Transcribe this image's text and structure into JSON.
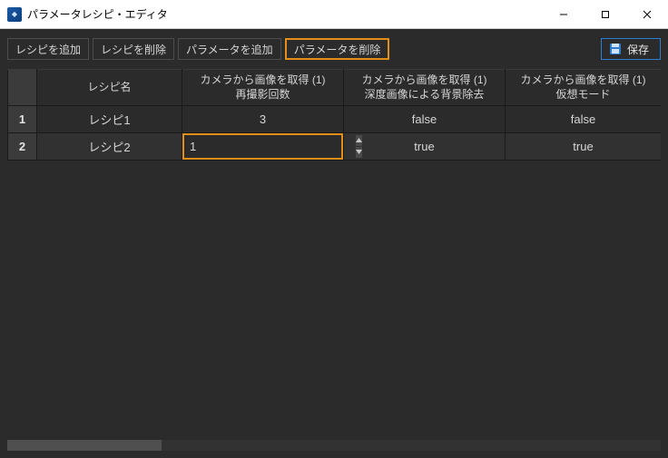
{
  "window": {
    "title": "パラメータレシピ・エディタ"
  },
  "toolbar": {
    "add_recipe": "レシピを追加",
    "delete_recipe": "レシピを削除",
    "add_param": "パラメータを追加",
    "delete_param": "パラメータを削除",
    "save": "保存"
  },
  "table": {
    "headers": {
      "name": "レシピ名",
      "col1_line1": "カメラから画像を取得 (1)",
      "col1_line2": "再撮影回数",
      "col2_line1": "カメラから画像を取得 (1)",
      "col2_line2": "深度画像による背景除去",
      "col3_line1": "カメラから画像を取得 (1)",
      "col3_line2": "仮想モード"
    },
    "rows": [
      {
        "idx": "1",
        "name": "レシピ1",
        "reshoot": "3",
        "bg": "false",
        "virtual": "false"
      },
      {
        "idx": "2",
        "name": "レシピ2",
        "reshoot": "1",
        "bg": "true",
        "virtual": "true"
      }
    ]
  }
}
